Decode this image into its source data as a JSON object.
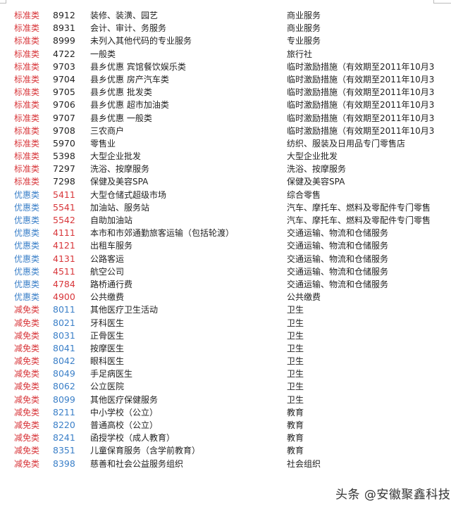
{
  "colors": {
    "red": "#d8363a",
    "blue": "#3a7fc8",
    "black": "#222222"
  },
  "rows": [
    {
      "category": "标准类",
      "code": "8912",
      "description": "装修、装潢、园艺",
      "industry": "商业服务",
      "cat_color": "red",
      "code_color": "black"
    },
    {
      "category": "标准类",
      "code": "8931",
      "description": "会计、审计、务服务",
      "industry": "商业服务",
      "cat_color": "red",
      "code_color": "black"
    },
    {
      "category": "标准类",
      "code": "8999",
      "description": "未列入其他代码的专业服务",
      "industry": "专业服务",
      "cat_color": "red",
      "code_color": "black"
    },
    {
      "category": "标准类",
      "code": "4722",
      "description": "一般类",
      "industry": "旅行社",
      "cat_color": "red",
      "code_color": "black"
    },
    {
      "category": "标准类",
      "code": "9703",
      "description": "县乡优惠 宾馆餐饮娱乐类",
      "industry": "临时激励措施（有效期至2011年10月3",
      "cat_color": "red",
      "code_color": "black"
    },
    {
      "category": "标准类",
      "code": "9704",
      "description": "县乡优惠 房产汽车类",
      "industry": "临时激励措施（有效期至2011年10月3",
      "cat_color": "red",
      "code_color": "black"
    },
    {
      "category": "标准类",
      "code": "9705",
      "description": "县乡优惠 批发类",
      "industry": "临时激励措施（有效期至2011年10月3",
      "cat_color": "red",
      "code_color": "black"
    },
    {
      "category": "标准类",
      "code": "9706",
      "description": "县乡优惠 超市加油类",
      "industry": "临时激励措施（有效期至2011年10月3",
      "cat_color": "red",
      "code_color": "black"
    },
    {
      "category": "标准类",
      "code": "9707",
      "description": "县乡优惠 一般类",
      "industry": "临时激励措施（有效期至2011年10月3",
      "cat_color": "red",
      "code_color": "black"
    },
    {
      "category": "标准类",
      "code": "9708",
      "description": "三农商户",
      "industry": "临时激励措施（有效期至2011年10月3",
      "cat_color": "red",
      "code_color": "black"
    },
    {
      "category": "标准类",
      "code": "5970",
      "description": "零售业",
      "industry": "纺织、服装及日用品专门零售店",
      "cat_color": "red",
      "code_color": "black"
    },
    {
      "category": "标准类",
      "code": "5398",
      "description": "大型企业批发",
      "industry": "大型企业批发",
      "cat_color": "red",
      "code_color": "black"
    },
    {
      "category": "标准类",
      "code": "7297",
      "description": "洗浴、按摩服务",
      "industry": "洗浴、按摩服务",
      "cat_color": "red",
      "code_color": "black"
    },
    {
      "category": "标准类",
      "code": "7298",
      "description": "保健及美容SPA",
      "industry": "保健及美容SPA",
      "cat_color": "red",
      "code_color": "black"
    },
    {
      "category": "优惠类",
      "code": "5411",
      "description": "大型仓储式超级市场",
      "industry": "综合零售",
      "cat_color": "blue",
      "code_color": "red"
    },
    {
      "category": "优惠类",
      "code": "5541",
      "description": "加油站、服务站",
      "industry": "汽车、摩托车、燃料及零配件专门零售",
      "cat_color": "blue",
      "code_color": "red"
    },
    {
      "category": "优惠类",
      "code": "5542",
      "description": "自助加油站",
      "industry": "汽车、摩托车、燃料及零配件专门零售",
      "cat_color": "blue",
      "code_color": "red"
    },
    {
      "category": "优惠类",
      "code": "4111",
      "description": "本市和市郊通勤旅客运输（包括轮渡）",
      "industry": "交通运输、物流和仓储服务",
      "cat_color": "blue",
      "code_color": "red"
    },
    {
      "category": "优惠类",
      "code": "4121",
      "description": "出租车服务",
      "industry": "交通运输、物流和仓储服务",
      "cat_color": "blue",
      "code_color": "red"
    },
    {
      "category": "优惠类",
      "code": "4131",
      "description": "公路客运",
      "industry": "交通运输、物流和仓储服务",
      "cat_color": "blue",
      "code_color": "red"
    },
    {
      "category": "优惠类",
      "code": "4511",
      "description": "航空公司",
      "industry": "交通运输、物流和仓储服务",
      "cat_color": "blue",
      "code_color": "red"
    },
    {
      "category": "优惠类",
      "code": "4784",
      "description": "路桥通行费",
      "industry": "交通运输、物流和仓储服务",
      "cat_color": "blue",
      "code_color": "red"
    },
    {
      "category": "优惠类",
      "code": "4900",
      "description": "公共缴费",
      "industry": "公共缴费",
      "cat_color": "blue",
      "code_color": "red"
    },
    {
      "category": "减免类",
      "code": "8011",
      "description": "其他医疗卫生活动",
      "industry": "卫生",
      "cat_color": "red",
      "code_color": "blue"
    },
    {
      "category": "减免类",
      "code": "8021",
      "description": "牙科医生",
      "industry": "卫生",
      "cat_color": "red",
      "code_color": "blue"
    },
    {
      "category": "减免类",
      "code": "8031",
      "description": "正骨医生",
      "industry": "卫生",
      "cat_color": "red",
      "code_color": "blue"
    },
    {
      "category": "减免类",
      "code": "8041",
      "description": "按摩医生",
      "industry": "卫生",
      "cat_color": "red",
      "code_color": "blue"
    },
    {
      "category": "减免类",
      "code": "8042",
      "description": "眼科医生",
      "industry": "卫生",
      "cat_color": "red",
      "code_color": "blue"
    },
    {
      "category": "减免类",
      "code": "8049",
      "description": "手足病医生",
      "industry": "卫生",
      "cat_color": "red",
      "code_color": "blue"
    },
    {
      "category": "减免类",
      "code": "8062",
      "description": "公立医院",
      "industry": "卫生",
      "cat_color": "red",
      "code_color": "blue"
    },
    {
      "category": "减免类",
      "code": "8099",
      "description": "其他医疗保健服务",
      "industry": "卫生",
      "cat_color": "red",
      "code_color": "blue"
    },
    {
      "category": "减免类",
      "code": "8211",
      "description": "中小学校（公立）",
      "industry": "教育",
      "cat_color": "red",
      "code_color": "blue"
    },
    {
      "category": "减免类",
      "code": "8220",
      "description": "普通高校（公立）",
      "industry": "教育",
      "cat_color": "red",
      "code_color": "blue"
    },
    {
      "category": "减免类",
      "code": "8241",
      "description": "函授学校（成人教育）",
      "industry": "教育",
      "cat_color": "red",
      "code_color": "blue"
    },
    {
      "category": "减免类",
      "code": "8351",
      "description": "儿童保育服务（含学前教育）",
      "industry": "教育",
      "cat_color": "red",
      "code_color": "blue"
    },
    {
      "category": "减免类",
      "code": "8398",
      "description": "慈善和社会公益服务组织",
      "industry": "社会组织",
      "cat_color": "red",
      "code_color": "blue"
    }
  ],
  "watermark": "头条 @安徽聚鑫科技"
}
